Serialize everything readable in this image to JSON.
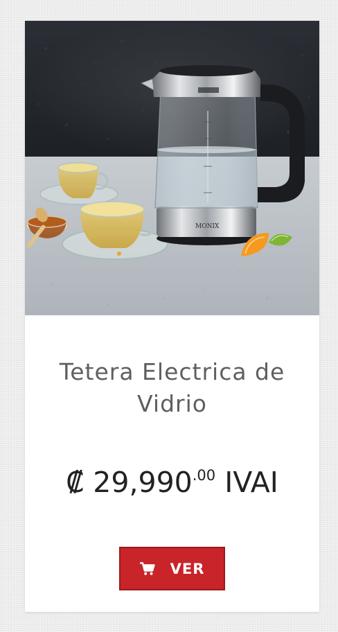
{
  "product": {
    "title": "Tetera Electrica de Vidrio",
    "image_alt": "Tetera eléctrica de vidrio con tazas de té",
    "kettle_brand": "MONIX",
    "price": {
      "currency": "₡",
      "amount": "29,990",
      "decimals": ".00",
      "suffix": "IVAI"
    },
    "button": {
      "label": "VER",
      "icon": "shopping-cart-icon"
    }
  },
  "colors": {
    "accent": "#c8242a",
    "title": "#5f5f5f",
    "price": "#222222",
    "background": "#ececec",
    "card": "#ffffff"
  }
}
